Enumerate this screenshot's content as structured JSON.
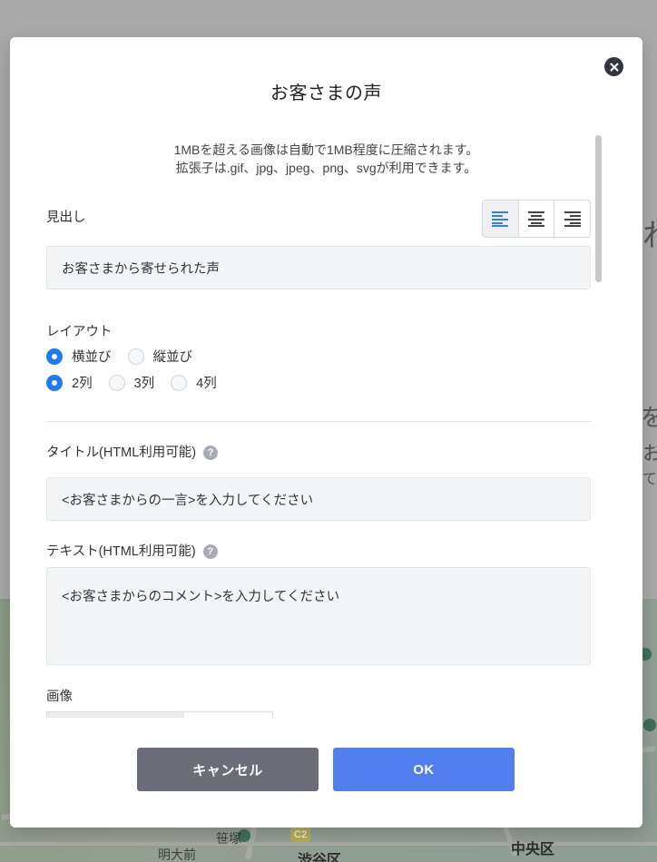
{
  "modal": {
    "title": "お客さまの声",
    "note_line1": "1MBを超える画像は自動で1MB程度に圧縮されます。",
    "note_line2": "拡張子は.gif、jpg、jpeg、png、svgが利用できます。",
    "heading_label": "見出し",
    "heading_value": "お客さまから寄せられた声",
    "alignment_options": [
      "left",
      "center",
      "right"
    ],
    "alignment_selected": "left",
    "layout_label": "レイアウト",
    "layout_direction": {
      "options": [
        "横並び",
        "縦並び"
      ],
      "selected": "横並び"
    },
    "layout_columns": {
      "options": [
        "2列",
        "3列",
        "4列"
      ],
      "selected": "2列"
    },
    "title_label": "タイトル(HTML利用可能)",
    "title_value": "<お客さまからの一言>を入力してください",
    "text_label": "テキスト(HTML利用可能)",
    "text_value": "<お客さまからのコメント>を入力してください",
    "image_label": "画像",
    "help_symbol": "?",
    "cancel_label": "キャンセル",
    "ok_label": "OK"
  },
  "background": {
    "text_big": "れ",
    "text_med": "をぉ",
    "text_sm": "て",
    "map_labels": {
      "chuo": "中央区",
      "shibuya": "渋谷区",
      "sasazuka": "笹塚",
      "meidaimae": "明大前",
      "ku_partial": "区",
      "badge": "C2"
    }
  },
  "colors": {
    "accent": "#1f7bf0",
    "ok_button": "#527ff0",
    "cancel_button": "#6b6e79",
    "field_bg": "#f4f5f7"
  }
}
